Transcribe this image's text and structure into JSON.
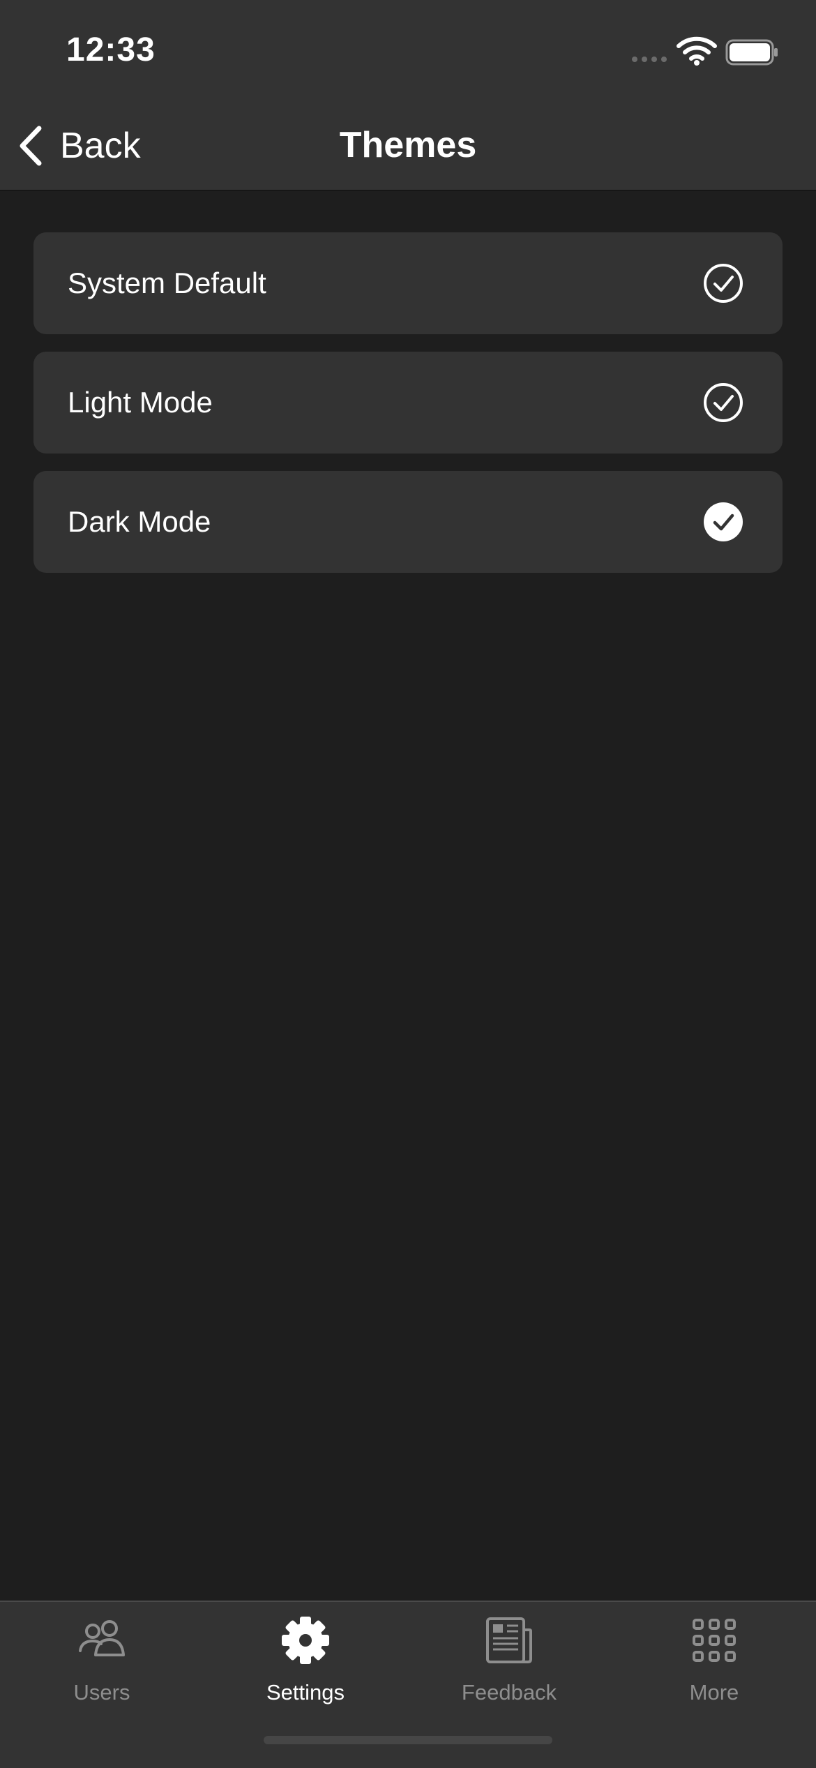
{
  "status": {
    "time": "12:33"
  },
  "nav": {
    "back_label": "Back",
    "title": "Themes"
  },
  "themes": [
    {
      "label": "System Default",
      "selected": false
    },
    {
      "label": "Light Mode",
      "selected": false
    },
    {
      "label": "Dark Mode",
      "selected": true
    }
  ],
  "tabs": [
    {
      "label": "Users",
      "icon": "users-icon",
      "active": false
    },
    {
      "label": "Settings",
      "icon": "gear-icon",
      "active": true
    },
    {
      "label": "Feedback",
      "icon": "newspaper-icon",
      "active": false
    },
    {
      "label": "More",
      "icon": "grid-icon",
      "active": false
    }
  ],
  "colors": {
    "background": "#1e1e1e",
    "surface": "#333333",
    "text_primary": "#ffffff",
    "tab_inactive": "#8e8e8e"
  }
}
